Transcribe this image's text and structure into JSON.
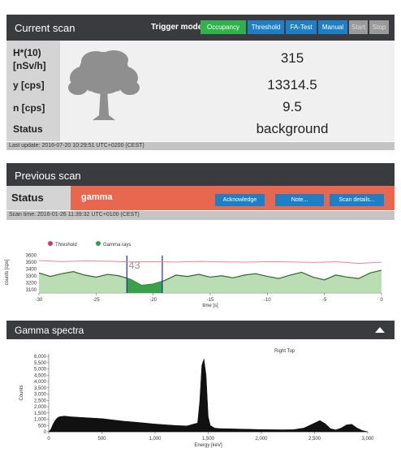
{
  "current_scan": {
    "title": "Current scan",
    "trigger_label": "Trigger mode:",
    "buttons": {
      "occupancy": "Occupancy",
      "threshold": "Threshold",
      "fa_test": "FA-Test",
      "manual": "Manual",
      "start": "Start",
      "stop": "Stop"
    },
    "labels": {
      "h10_line1": "H*(10)",
      "h10_line2": "[nSv/h]",
      "y": "y [cps]",
      "n": "n [cps]",
      "status": "Status"
    },
    "values": {
      "h10": "315",
      "y": "13314.5",
      "n": "9.5",
      "status": "background"
    },
    "last_update": "Last update: 2016-07-20 10:29:51 UTC+0200 (CEST)"
  },
  "previous_scan": {
    "title": "Previous scan",
    "status_label": "Status",
    "status_value": "gamma",
    "buttons": {
      "acknowledge": "Acknowledge",
      "note": "Note...",
      "scan_details": "Scan details..."
    },
    "scan_time": "Scan time: 2016-01-26 11:39:32 UTC+0100 (CEST)"
  },
  "colors": {
    "header_bg": "#3a3b3f",
    "occupancy_green": "#2fb14b",
    "button_blue": "#1f7fc6",
    "alarm_red": "#e8674f",
    "threshold_line": "#e08a9a",
    "gamma_fill": "#a9d4a0",
    "gamma_line": "#2d6a2d"
  },
  "chart_data": [
    {
      "type": "area",
      "legend": [
        "Threshold",
        "Gamma rays"
      ],
      "ylabel": "counts [cps]",
      "xlabel": "time [s]",
      "y_ticks": [
        "3600",
        "3500",
        "3400",
        "3300",
        "3200",
        "3100"
      ],
      "x_ticks": [
        "-30",
        "-25",
        "-20",
        "-15",
        "-10",
        "-5",
        "0"
      ],
      "ylim": [
        3050,
        3650
      ],
      "xlim": [
        -30,
        0
      ],
      "highlight": {
        "from": -22.3,
        "to": -19.2,
        "label": "43"
      },
      "series": [
        {
          "name": "Threshold",
          "x": [
            -30,
            -28,
            -26,
            -24,
            -22,
            -20,
            -18,
            -16,
            -14,
            -12,
            -10,
            -8,
            -6,
            -4,
            -2,
            0
          ],
          "values": [
            3520,
            3505,
            3515,
            3510,
            3500,
            3505,
            3498,
            3508,
            3502,
            3497,
            3505,
            3500,
            3493,
            3503,
            3480,
            3495
          ]
        },
        {
          "name": "Gamma rays",
          "x": [
            -30,
            -29,
            -28,
            -27,
            -26,
            -25,
            -24,
            -23,
            -22,
            -21,
            -20,
            -19,
            -18,
            -17,
            -16,
            -15,
            -14,
            -13,
            -12,
            -11,
            -10,
            -9,
            -8,
            -7,
            -6,
            -5,
            -4,
            -3,
            -2,
            -1,
            0
          ],
          "values": [
            3340,
            3290,
            3330,
            3360,
            3310,
            3280,
            3320,
            3300,
            3250,
            3160,
            3180,
            3230,
            3310,
            3290,
            3320,
            3280,
            3300,
            3270,
            3310,
            3330,
            3290,
            3260,
            3310,
            3350,
            3280,
            3240,
            3310,
            3280,
            3260,
            3340,
            3380
          ]
        }
      ]
    },
    {
      "type": "area",
      "title": "Gamma spectra",
      "annotation": "Right Top",
      "xlabel": "Energy [keV]",
      "ylabel": "Counts",
      "y_ticks": [
        "6,000",
        "5,500",
        "5,000",
        "4,500",
        "4,000",
        "3,500",
        "3,000",
        "2,500",
        "2,000",
        "1,500",
        "1,000",
        "500",
        "0"
      ],
      "x_ticks": [
        "0",
        "500",
        "1,000",
        "1,500",
        "2,000",
        "2,500",
        "3,000"
      ],
      "xlim": [
        0,
        3000
      ],
      "ylim": [
        0,
        6200
      ],
      "series": [
        {
          "name": "",
          "x": [
            0,
            20,
            40,
            60,
            80,
            100,
            150,
            200,
            300,
            400,
            500,
            600,
            700,
            800,
            900,
            1000,
            1100,
            1200,
            1300,
            1400,
            1420,
            1440,
            1460,
            1480,
            1500,
            1520,
            1560,
            1600,
            1700,
            1800,
            1900,
            2000,
            2100,
            2200,
            2300,
            2400,
            2500,
            2550,
            2600,
            2650,
            2700,
            2750,
            2800,
            2850,
            2900,
            2950,
            3000
          ],
          "values": [
            0,
            200,
            600,
            900,
            1100,
            1200,
            1250,
            1200,
            1150,
            1100,
            1050,
            950,
            850,
            780,
            700,
            620,
            560,
            500,
            470,
            700,
            2400,
            5300,
            5800,
            4500,
            1200,
            500,
            300,
            260,
            240,
            220,
            200,
            180,
            170,
            160,
            170,
            300,
            700,
            900,
            650,
            250,
            150,
            300,
            550,
            600,
            300,
            100,
            0
          ]
        }
      ]
    }
  ]
}
